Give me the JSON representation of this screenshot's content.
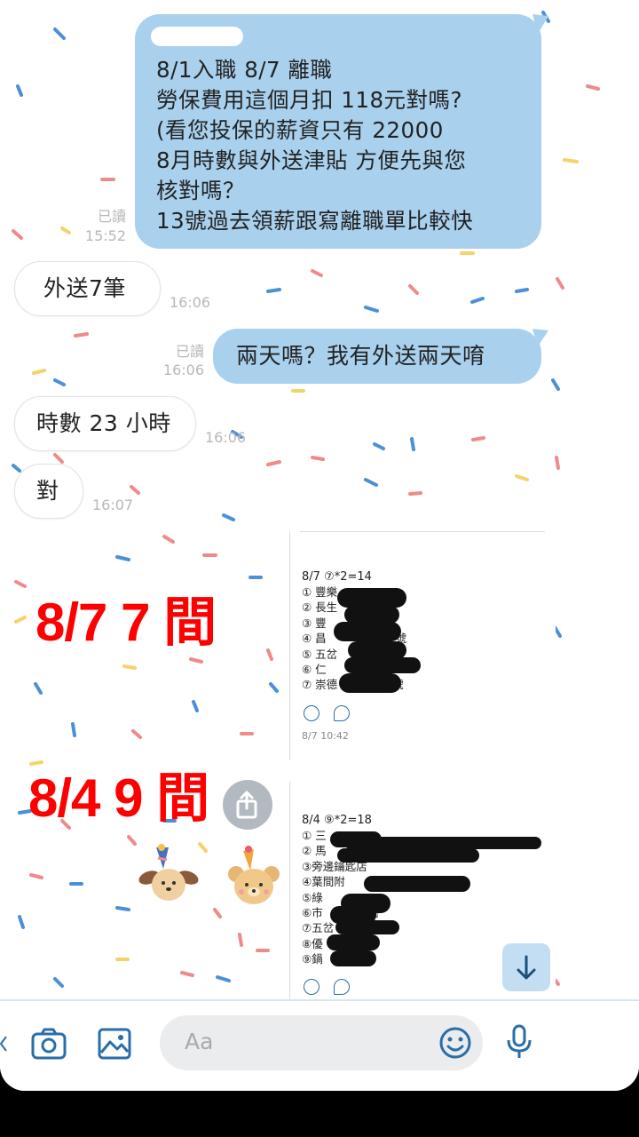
{
  "messages": {
    "m1": {
      "text": "8/1入職 8/7 離職\n勞保費用這個月扣 118元對嗎?\n(看您投保的薪資只有 22000\n8月時數與外送津貼 方便先與您\n核對嗎？\n13號過去領薪跟寫離職單比較快",
      "read": "已讀",
      "time": "15:52"
    },
    "m2": {
      "text": "外送7筆",
      "time": "16:06"
    },
    "m3": {
      "text": "兩天嗎？我有外送兩天唷",
      "read": "已讀",
      "time": "16:06"
    },
    "m4": {
      "text": "時數 23 小時",
      "time": "16:06"
    },
    "m5": {
      "text": "對",
      "time": "16:07"
    }
  },
  "annotations": {
    "a1": "8/7 7 間",
    "a2": "8/4 9 間"
  },
  "screenshot1": {
    "header": "8/7 ⑦*2=14",
    "lines": "① 豐樂\n② 長生\n③ 豐\n④ 昌　　　　225 號\n⑤ 五岔\n⑥ 仁\n⑦ 崇德　　　　8 號",
    "time": "8/7 10:42"
  },
  "screenshot2": {
    "header": "8/4 ⑨*2=18",
    "lines": "① 三\n② 馬　　　　　　　316\n③旁邊鑰匙店\n④葉間附\n⑤綠\n⑥市　　　骨麵\n⑦五岔\n⑧優\n⑨鍋　　　多"
  },
  "input": {
    "placeholder": "Aa"
  },
  "icons": {
    "camera": "camera-icon",
    "gallery": "image-icon",
    "emoji": "emoji-icon",
    "mic": "microphone-icon",
    "share": "share-icon",
    "scroll": "arrow-down-icon",
    "smile": "smile-icon",
    "comment": "comment-icon"
  },
  "colors": {
    "outgoing": "#a9d1ee",
    "incoming": "#ffffff",
    "accent": "#2a6ea8",
    "annotation": "#ff0000"
  }
}
